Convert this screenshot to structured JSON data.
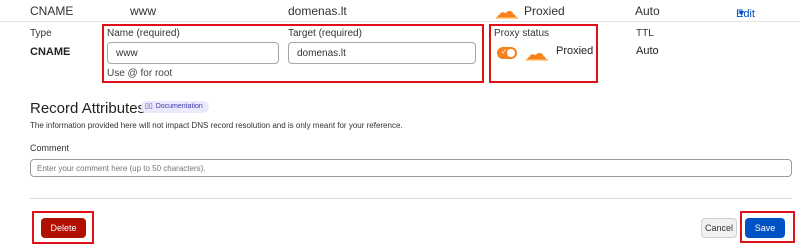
{
  "summary_row": {
    "type": "CNAME",
    "name": "www",
    "content": "domenas.lt",
    "proxy_status": "Proxied",
    "ttl": "Auto",
    "edit_label": "Edit"
  },
  "edit_form": {
    "type_label": "Type",
    "type_value": "CNAME",
    "name_label": "Name (required)",
    "name_value": "www",
    "name_hint": "Use @ for root",
    "target_label": "Target (required)",
    "target_value": "domenas.lt",
    "proxy_label": "Proxy status",
    "proxy_value": "Proxied",
    "ttl_label": "TTL",
    "ttl_value": "Auto"
  },
  "record_attributes": {
    "title": "Record Attributes",
    "doc_badge": "Documentation",
    "description": "The information provided here will not impact DNS record resolution and is only meant for your reference.",
    "comment_label": "Comment",
    "comment_placeholder": "Enter your comment here (up to 50 characters)."
  },
  "actions": {
    "delete_label": "Delete",
    "cancel_label": "Cancel",
    "save_label": "Save"
  },
  "colors": {
    "accent": "#0051c3",
    "cloud_orange": "#f6821f",
    "danger": "#b20f03",
    "highlight": "#e0101a"
  }
}
